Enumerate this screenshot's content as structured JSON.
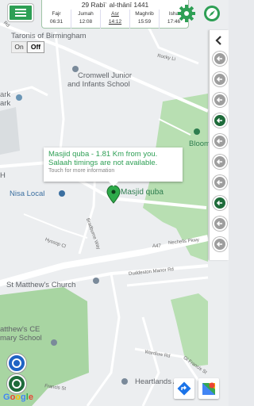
{
  "header": {
    "hijri_date": "29 Rabīʿ al-thānī 1441",
    "prayers": [
      {
        "name": "Fajr",
        "time": "06:31"
      },
      {
        "name": "Jumah",
        "time": "12:08"
      },
      {
        "name": "Asr",
        "time": "14:12"
      },
      {
        "name": "Maghrib",
        "time": "15:59"
      },
      {
        "name": "Isha",
        "time": "17:46"
      }
    ]
  },
  "toggle": {
    "on": "On",
    "off": "Off"
  },
  "map_labels": {
    "place_top": "Taronis of Birmingham",
    "school_1_line1": "Cromwell Junior",
    "school_1_line2": "and Infants School",
    "park_1": "ark",
    "park_2": "ark",
    "bloomsbury": "Bloomsbu",
    "h_label": "H",
    "nisa": "Nisa Local",
    "masjid": "Masjid quba",
    "st_matthews": "St Matthew's Church",
    "school_2_line1": "atthew's CE",
    "school_2_line2": "mary School",
    "heartlands": "Heartlands Acad",
    "rocky_ln": "Rocky Li",
    "a47": "A47",
    "nechells": "Nechells Pkwy",
    "duddeston": "Duddeston Manor Rd",
    "wardlow": "Wardlow Rd",
    "gl_francis": "Gl Francis St",
    "francis_st": "Francis St",
    "hyssop": "Hyssop Cl",
    "bradburne": "Bradburne Way",
    "rd_top": "Rd"
  },
  "info_window": {
    "line1": "Masjid quba - 1.81 Km from you.",
    "line2": "Salaah timings are not available.",
    "line3": "Touch for more information"
  },
  "branding": {
    "google": "Google"
  },
  "colors": {
    "primary_green": "#2e9f55",
    "dark_green": "#1e6b3a",
    "park_green": "#a8d5a2",
    "water_blue": "#1f63c4"
  },
  "icons": {
    "menu": "hamburger-icon",
    "settings": "gear-icon",
    "qibla": "compass-icon",
    "marker": "map-pin-icon"
  }
}
